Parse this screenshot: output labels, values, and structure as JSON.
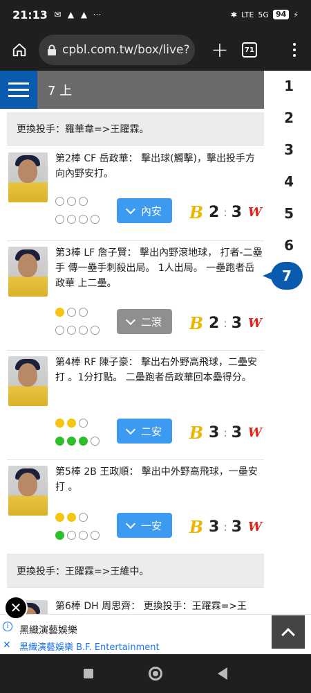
{
  "status": {
    "time": "21:13",
    "battery": "94",
    "signal": "5G",
    "network": "LTE"
  },
  "browser": {
    "url": "cpbl.com.tw/box/live?",
    "tab_count": "71"
  },
  "inning": {
    "title": "7 上"
  },
  "side_nav": {
    "items": [
      "1",
      "2",
      "3",
      "4",
      "5",
      "6"
    ],
    "active": "7"
  },
  "events": {
    "change1": "更換投手：羅華韋=>王躍霖。",
    "change2": "更換投手：王躍霖=>王維中。"
  },
  "plays": [
    {
      "text": "第2棒 CF 岳政華： 擊出球(觸擊)，擊出投手方向內野安打。",
      "result": "內安",
      "score_a": "2",
      "score_b": "3",
      "outs": 0,
      "bases": [
        false,
        false,
        false,
        false
      ]
    },
    {
      "text": "第3棒 LF 詹子賢： 擊出內野滾地球， 打者-二壘手 傳一壘手刺殺出局。 1人出局。 一壘跑者岳政華 上二壘。",
      "result": "二滾",
      "score_a": "2",
      "score_b": "3",
      "outs": 1,
      "bases": [
        false,
        false,
        false,
        false
      ]
    },
    {
      "text": "第4棒 RF 陳子豪： 擊出右外野高飛球，二壘安打 。1分打點。 二壘跑者岳政華回本壘得分。",
      "result": "二安",
      "score_a": "3",
      "score_b": "3",
      "outs": 2,
      "bases": [
        true,
        true,
        true,
        false
      ]
    },
    {
      "text": "第5棒 2B 王政順： 擊出中外野高飛球，一壘安打 。",
      "result": "一安",
      "score_a": "3",
      "score_b": "3",
      "outs": 2,
      "bases": [
        true,
        false,
        false,
        false
      ]
    },
    {
      "text": "第6棒 DH 周思齊： 更換投手：王躍霖=>王"
    }
  ],
  "teams": {
    "a_logo": "B",
    "b_logo": "W",
    "a_color": "#e9b800",
    "b_color": "#e2231a"
  },
  "ad": {
    "title": "黑織演藝娛樂",
    "subtitle": "黑織演藝娛樂 B.F. Entertainment"
  },
  "colors": {
    "accent": "#0a5bb0",
    "result_button": "#3c9bf0",
    "out_light": "#f5c311",
    "base_light": "#2cc02c"
  }
}
